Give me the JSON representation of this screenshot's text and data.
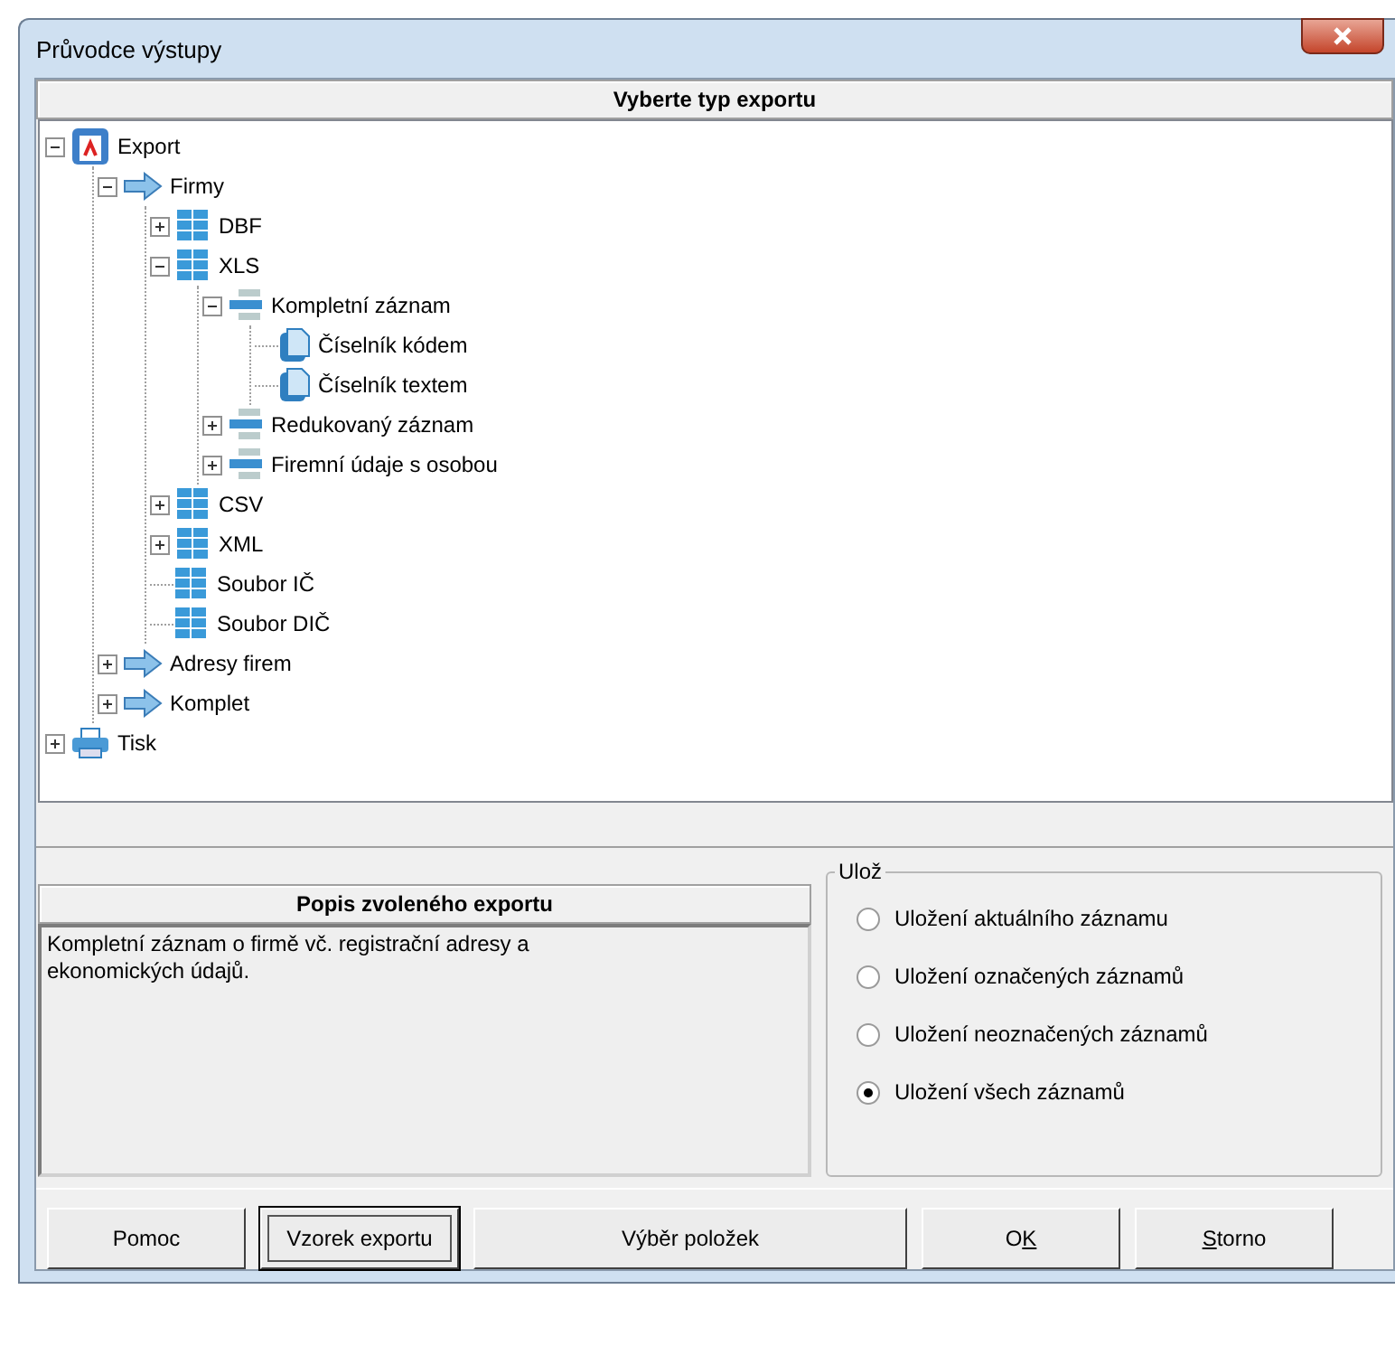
{
  "window": {
    "title": "Průvodce výstupy"
  },
  "tree_header": "Vyberte typ exportu",
  "tree": [
    {
      "label": "Export",
      "kind": "export",
      "expanded": true,
      "children": [
        {
          "label": "Firmy",
          "kind": "arrow",
          "expanded": true,
          "children": [
            {
              "label": "DBF",
              "kind": "grid",
              "expanded": false
            },
            {
              "label": "XLS",
              "kind": "grid",
              "expanded": true,
              "children": [
                {
                  "label": "Kompletní záznam",
                  "kind": "record",
                  "expanded": true,
                  "children": [
                    {
                      "label": "Číselník kódem",
                      "kind": "doc"
                    },
                    {
                      "label": "Číselník textem",
                      "kind": "doc"
                    }
                  ]
                },
                {
                  "label": "Redukovaný záznam",
                  "kind": "record",
                  "expanded": false
                },
                {
                  "label": "Firemní údaje s osobou",
                  "kind": "record",
                  "expanded": false
                }
              ]
            },
            {
              "label": "CSV",
              "kind": "grid",
              "expanded": false
            },
            {
              "label": "XML",
              "kind": "grid",
              "expanded": false
            },
            {
              "label": "Soubor IČ",
              "kind": "grid"
            },
            {
              "label": "Soubor DIČ",
              "kind": "grid"
            }
          ]
        },
        {
          "label": "Adresy firem",
          "kind": "arrow",
          "expanded": false
        },
        {
          "label": "Komplet",
          "kind": "arrow",
          "expanded": false
        }
      ]
    },
    {
      "label": "Tisk",
      "kind": "printer",
      "expanded": false
    }
  ],
  "description": {
    "header": "Popis zvoleného exportu",
    "text": "Kompletní záznam o firmě vč. registrační adresy a ekonomických údajů."
  },
  "save_group": {
    "legend": "Ulož",
    "options": [
      {
        "label": "Uložení aktuálního záznamu",
        "selected": false
      },
      {
        "label": "Uložení označených záznamů",
        "selected": false
      },
      {
        "label": "Uložení neoznačených záznamů",
        "selected": false
      },
      {
        "label": "Uložení všech záznamů",
        "selected": true
      }
    ]
  },
  "buttons": [
    {
      "label": "Pomoc",
      "focused": false,
      "kind": "normal"
    },
    {
      "label": "Vzorek exportu",
      "focused": true,
      "kind": "normal"
    },
    {
      "label": "Výběr položek",
      "focused": false,
      "kind": "wide"
    },
    {
      "before": "O",
      "key": "K",
      "focused": false,
      "kind": "normal"
    },
    {
      "key": "S",
      "after": "torno",
      "focused": false,
      "kind": "normal"
    }
  ]
}
